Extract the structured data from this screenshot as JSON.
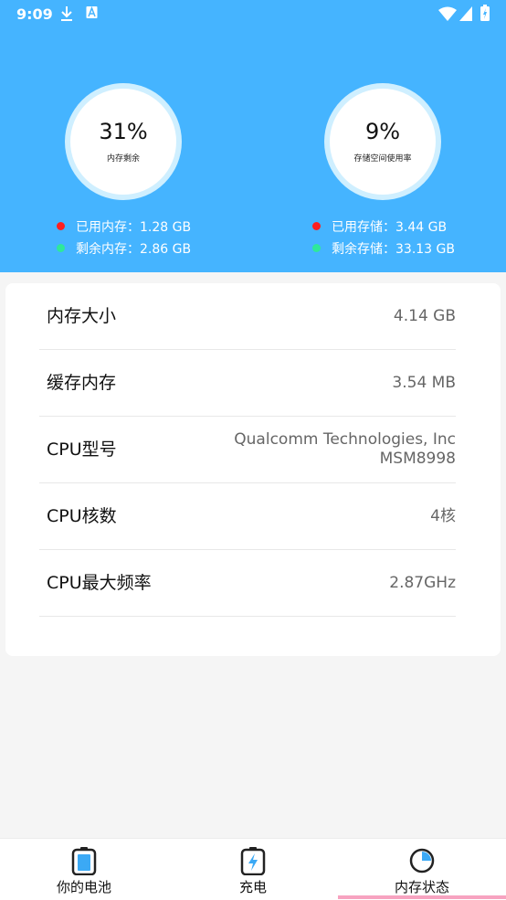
{
  "status_bar": {
    "time": "9:09"
  },
  "memory_gauge": {
    "percent_text": "31%",
    "percent_value": 31,
    "label": "内存剩余"
  },
  "storage_gauge": {
    "percent_text": "9%",
    "percent_value": 9,
    "label": "存储空间使用率"
  },
  "memory_legend": {
    "used": "已用内存：1.28 GB",
    "free": "剩余内存：2.86 GB"
  },
  "storage_legend": {
    "used": "已用存储：3.44 GB",
    "free": "剩余存储：33.13 GB"
  },
  "colors": {
    "header": "#45b4ff",
    "ring_track": "#cfefff",
    "ring_progress": "#2f5bff",
    "used_dot": "#ff1f1f",
    "free_dot": "#2ee89a"
  },
  "info_rows": [
    {
      "label": "内存大小",
      "value": "4.14 GB"
    },
    {
      "label": "缓存内存",
      "value": "3.54 MB"
    },
    {
      "label": "CPU型号",
      "value": "Qualcomm Technologies, Inc\nMSM8998"
    },
    {
      "label": "CPU核数",
      "value": "4核"
    },
    {
      "label": "CPU最大频率",
      "value": "2.87GHz"
    }
  ],
  "bottom_nav": [
    {
      "label": "你的电池",
      "icon": "battery-icon"
    },
    {
      "label": "充电",
      "icon": "charging-icon"
    },
    {
      "label": "内存状态",
      "icon": "memory-icon"
    }
  ]
}
